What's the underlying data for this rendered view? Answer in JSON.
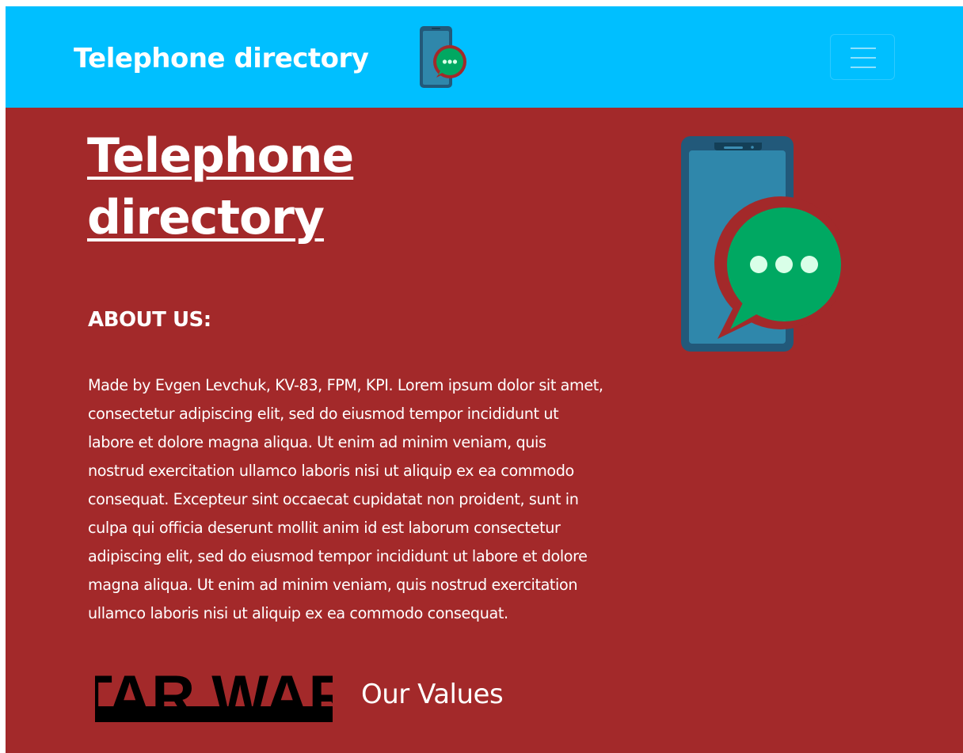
{
  "navbar": {
    "brand": "Telephone directory",
    "logo_icon": "phone-chat-icon",
    "menu_icon": "hamburger-menu-icon",
    "background_color": "#00bfff"
  },
  "hero": {
    "title": "Telephone directory",
    "image_icon": "phone-chat-icon",
    "background_color": "#a3292a"
  },
  "about": {
    "heading": "ABOUT US:",
    "text": "Made by Evgen Levchuk, KV-83, FPM, KPI. Lorem ipsum dolor sit amet, consectetur adipiscing elit, sed do eiusmod tempor incididunt ut labore et dolore magna aliqua. Ut enim ad minim veniam, quis nostrud exercitation ullamco laboris nisi ut aliquip ex ea commodo consequat. Excepteur sint occaecat cupidatat non proident, sunt in culpa qui officia deserunt mollit anim id est laborum consectetur adipiscing elit, sed do eiusmod tempor incididunt ut labore et dolore magna aliqua. Ut enim ad minim veniam, quis nostrud exercitation ullamco laboris nisi ut aliquip ex ea commodo consequat."
  },
  "values": {
    "heading": "Our Values",
    "logo_text": "STAR WARS"
  },
  "colors": {
    "phone_body": "#22597a",
    "phone_screen": "#2f87ab",
    "chat_bubble": "#00a862",
    "chat_outline": "#a3292a",
    "chat_dots": "#d9ffe8"
  }
}
